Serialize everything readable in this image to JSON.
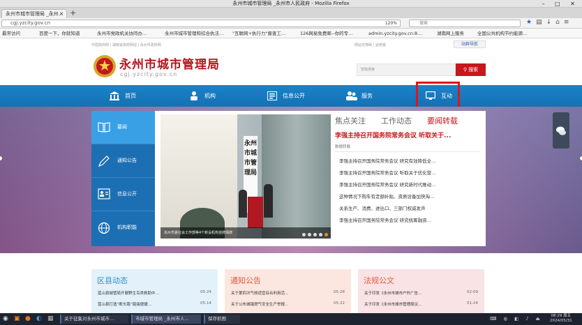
{
  "window": {
    "title": "永州市城市管理局 _永州市人民政府 - Mozilla Firefox"
  },
  "tab": {
    "label": "永州市城市管理局 _永州…",
    "close": "✕",
    "new": "+"
  },
  "nav": {
    "url": "cgj.yzcity.gov.cn",
    "zoom": "120%",
    "search_placeholder": "搜索"
  },
  "bookmarks": [
    "最常访问",
    "百度一下，你就知道",
    "永州市党政机关协同办…",
    "永州市城市管理和综合执法…",
    "\"互联网+执行力\"督查工…",
    "126网易免费邮--你的专…",
    "admin.yzcity.gov.cn:8…",
    "湖南网上服务",
    "全国公共机构节约能源…"
  ],
  "site": {
    "top_links": "中国政府网 | 湖南省政府网站 | 永州市政府网",
    "top_links_right": "网站无障碍 | 适老版",
    "nav_dropdown": "站群导航",
    "title": "永州市城市管理局",
    "subtitle": "cgj.yzcity.gov.cn",
    "search_placeholder": "智能搜索",
    "search_button": "搜索"
  },
  "main_nav": [
    {
      "label": "首页",
      "icon": "bank-icon"
    },
    {
      "label": "机构",
      "icon": "org-icon"
    },
    {
      "label": "信息公开",
      "icon": "info-icon"
    },
    {
      "label": "服务",
      "icon": "users-icon"
    },
    {
      "label": "互动",
      "icon": "monitor-icon"
    }
  ],
  "side_menu": [
    {
      "label": "要闻",
      "icon": "book-icon"
    },
    {
      "label": "通知公告",
      "icon": "pen-icon"
    },
    {
      "label": "信息公开",
      "icon": "id-card-icon"
    },
    {
      "label": "机构职能",
      "icon": "globe-icon"
    }
  ],
  "photo": {
    "plaque": "永州市城市管理局",
    "caption": "永州市委社会工作部等4个新设机构挂牌揭牌"
  },
  "news_tabs": [
    "焦点关注",
    "工作动态",
    "要闻转载"
  ],
  "headline": "李强主持召开国务院常务会议 听取关于...",
  "sub_label": "数据转载",
  "news_items": [
    "李强主持召开国务院常务会议 研究有效降低全…",
    "李强主持召开国务院常务会议 听取关于优化营…",
    "李强主持召开国务院常务会议 研究新时代推动…",
    "这种情况下购车有定额补贴、资质设备加快淘…",
    "关系生产、消费、进出口，三部门权威发声",
    "李强主持召开国务院常务会议 研究统筹融资…"
  ],
  "sections": [
    {
      "title": "区县动态",
      "items": [
        {
          "text": "蓝山县城管局开展野生鸟类救助中…",
          "date": "05-24"
        },
        {
          "text": "蓝山县打造“断头路”链接便捷…",
          "date": "05-14"
        }
      ]
    },
    {
      "title": "通知公告",
      "items": [
        {
          "text": "关于第四次气候适宜综合利用活…",
          "date": "05-28"
        },
        {
          "text": "关于公布城镇燃气安全生产举报…",
          "date": "05-22"
        }
      ]
    },
    {
      "title": "法规公文",
      "items": [
        {
          "text": "关于印发《永州市城市户外广告…",
          "date": "02-09"
        },
        {
          "text": "关于印发《永州市城市管理局议…",
          "date": "01-24"
        }
      ]
    }
  ],
  "taskbar": {
    "items": [
      "关于征集对永州市城市…",
      "市城市管理局 _永州市人…",
      "保存抓图"
    ],
    "clock_time": "08:29 周五",
    "clock_date": "2024/05/31"
  },
  "colors": {
    "brand_red": "#c8161d",
    "nav_blue": "#1571b4",
    "highlight_box": "#e0141c"
  }
}
